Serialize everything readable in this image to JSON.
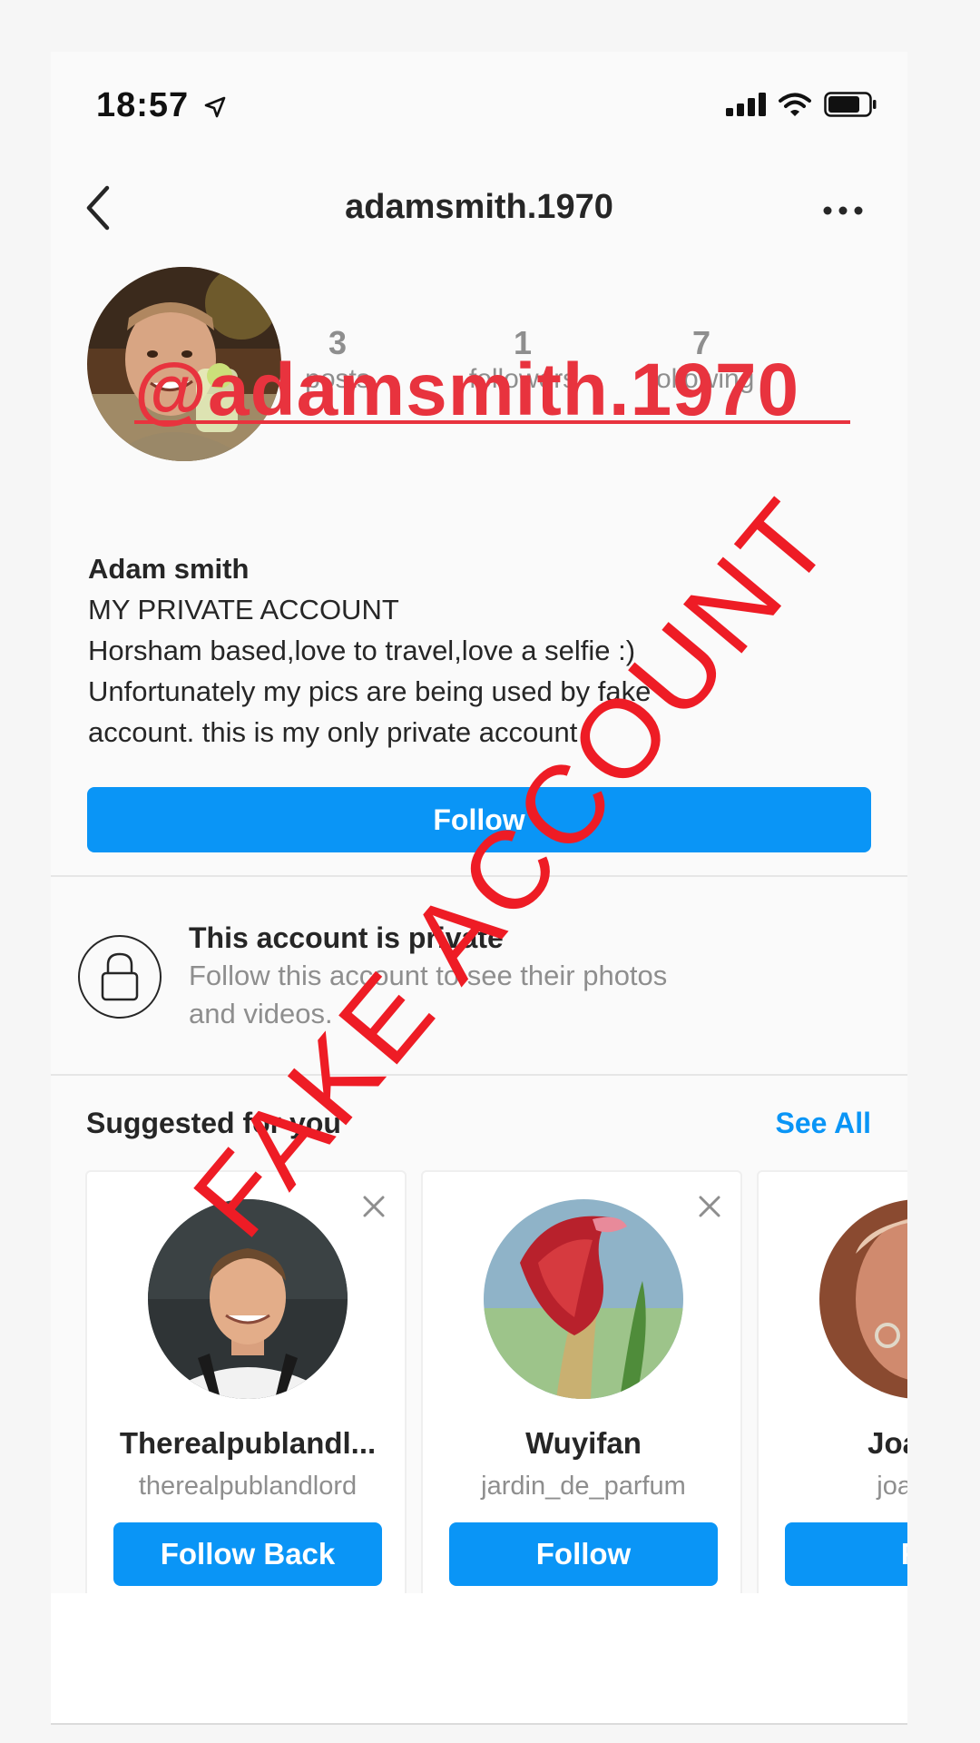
{
  "status_bar": {
    "time": "18:57"
  },
  "nav": {
    "title": "adamsmith.1970"
  },
  "profile": {
    "stats": [
      {
        "value": "3",
        "label": "posts"
      },
      {
        "value": "1",
        "label": "followers"
      },
      {
        "value": "7",
        "label": "following"
      }
    ],
    "name": "Adam smith",
    "bio_lines": [
      "MY PRIVATE ACCOUNT",
      "Horsham based,love to travel,love a selfie :)",
      "Unfortunately my pics are being used by fake",
      "account. this is my only private account"
    ],
    "follow_label": "Follow"
  },
  "private_notice": {
    "title": "This account is private",
    "line1": "Follow this account to see their photos",
    "line2": "and videos."
  },
  "suggestions": {
    "title": "Suggested for you",
    "see_all": "See All",
    "cards": [
      {
        "name": "Therealpublandl...",
        "username": "therealpublandlord",
        "button": "Follow Back"
      },
      {
        "name": "Wuyifan",
        "username": "jardin_de_parfum",
        "button": "Follow"
      },
      {
        "name": "Joan M",
        "username": "joanmc",
        "button": "Fo"
      }
    ]
  },
  "overlays": {
    "handle": "@adamsmith.1970",
    "stamp": "FAKE ACCOUNT"
  },
  "colors": {
    "accent": "#0a95f6",
    "stamp": "#ee1c25",
    "handle_overlay": "#e8333e"
  }
}
